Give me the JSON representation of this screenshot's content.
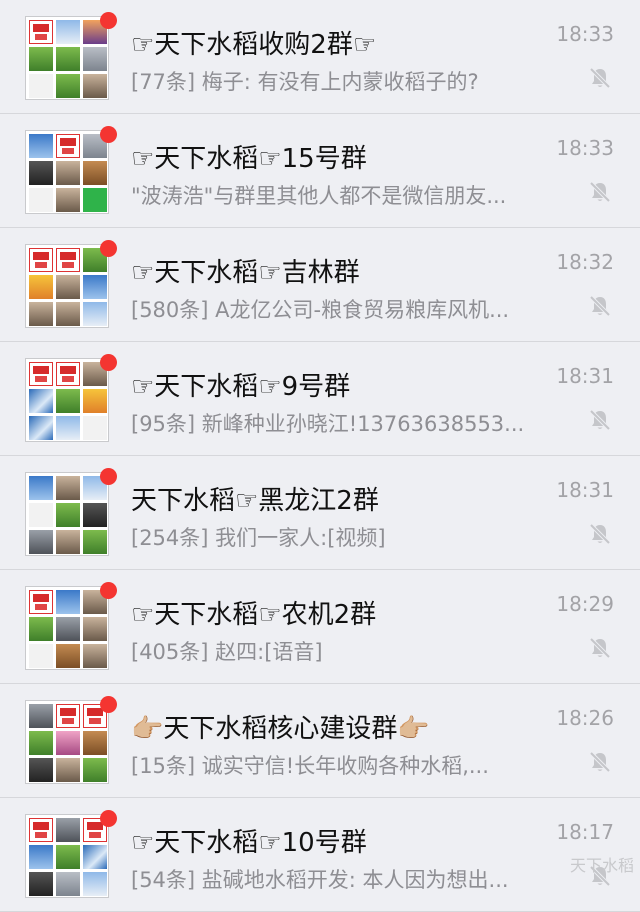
{
  "chats": [
    {
      "title": "☞天下水稻收购2群☞",
      "preview": "[77条] 梅子: 有没有上内蒙收稻子的?",
      "time": "18:33",
      "avatar": [
        "logo",
        "t-sky",
        "t-sunset",
        "t-field",
        "t-field",
        "t-gray",
        "t-white",
        "t-field",
        "t-person"
      ]
    },
    {
      "title": "☞天下水稻☞15号群",
      "preview": "\"波涛浩\"与群里其他人都不是微信朋友...",
      "time": "18:33",
      "avatar": [
        "t-blue",
        "logo",
        "t-gray",
        "t-dark",
        "t-person",
        "t-brown",
        "t-white",
        "t-person",
        "t-green"
      ]
    },
    {
      "title": "☞天下水稻☞吉林群",
      "preview": "[580条] A龙亿公司-粮食贸易粮库风机...",
      "time": "18:32",
      "avatar": [
        "logo",
        "logo",
        "t-field",
        "t-orange",
        "t-person",
        "t-blue",
        "t-person",
        "t-person",
        "t-sky"
      ]
    },
    {
      "title": "☞天下水稻☞9号群",
      "preview": "[95条] 新峰种业孙晓江!13763638553...",
      "time": "18:31",
      "avatar": [
        "logo",
        "logo",
        "t-person",
        "t-wave",
        "t-field",
        "t-orange",
        "t-wave",
        "t-sky",
        "t-white"
      ]
    },
    {
      "title": "天下水稻☞黑龙江2群",
      "preview": "[254条] 我们一家人:[视频]",
      "time": "18:31",
      "avatar": [
        "t-blue",
        "t-person",
        "t-sky",
        "t-white",
        "t-field",
        "t-dark",
        "t-road",
        "t-person",
        "t-field"
      ]
    },
    {
      "title": "☞天下水稻☞农机2群",
      "preview": "[405条] 赵四:[语音]",
      "time": "18:29",
      "avatar": [
        "logo",
        "t-blue",
        "t-person",
        "t-field",
        "t-road",
        "t-person",
        "t-white",
        "t-brown",
        "t-person"
      ]
    },
    {
      "title": "👉🏼天下水稻核心建设群👉🏼",
      "preview": "[15条] 诚实守信!长年收购各种水稻,...",
      "time": "18:26",
      "avatar": [
        "t-road",
        "logo",
        "logo",
        "t-field",
        "t-pink",
        "t-brown",
        "t-dark",
        "t-person",
        "t-field"
      ]
    },
    {
      "title": "☞天下水稻☞10号群",
      "preview": "[54条] 盐碱地水稻开发: 本人因为想出...",
      "time": "18:17",
      "avatar": [
        "logo",
        "t-road",
        "logo",
        "t-blue",
        "t-field",
        "t-wave",
        "t-dark",
        "t-gray",
        "t-sky"
      ]
    }
  ],
  "watermark": "天下水稻"
}
